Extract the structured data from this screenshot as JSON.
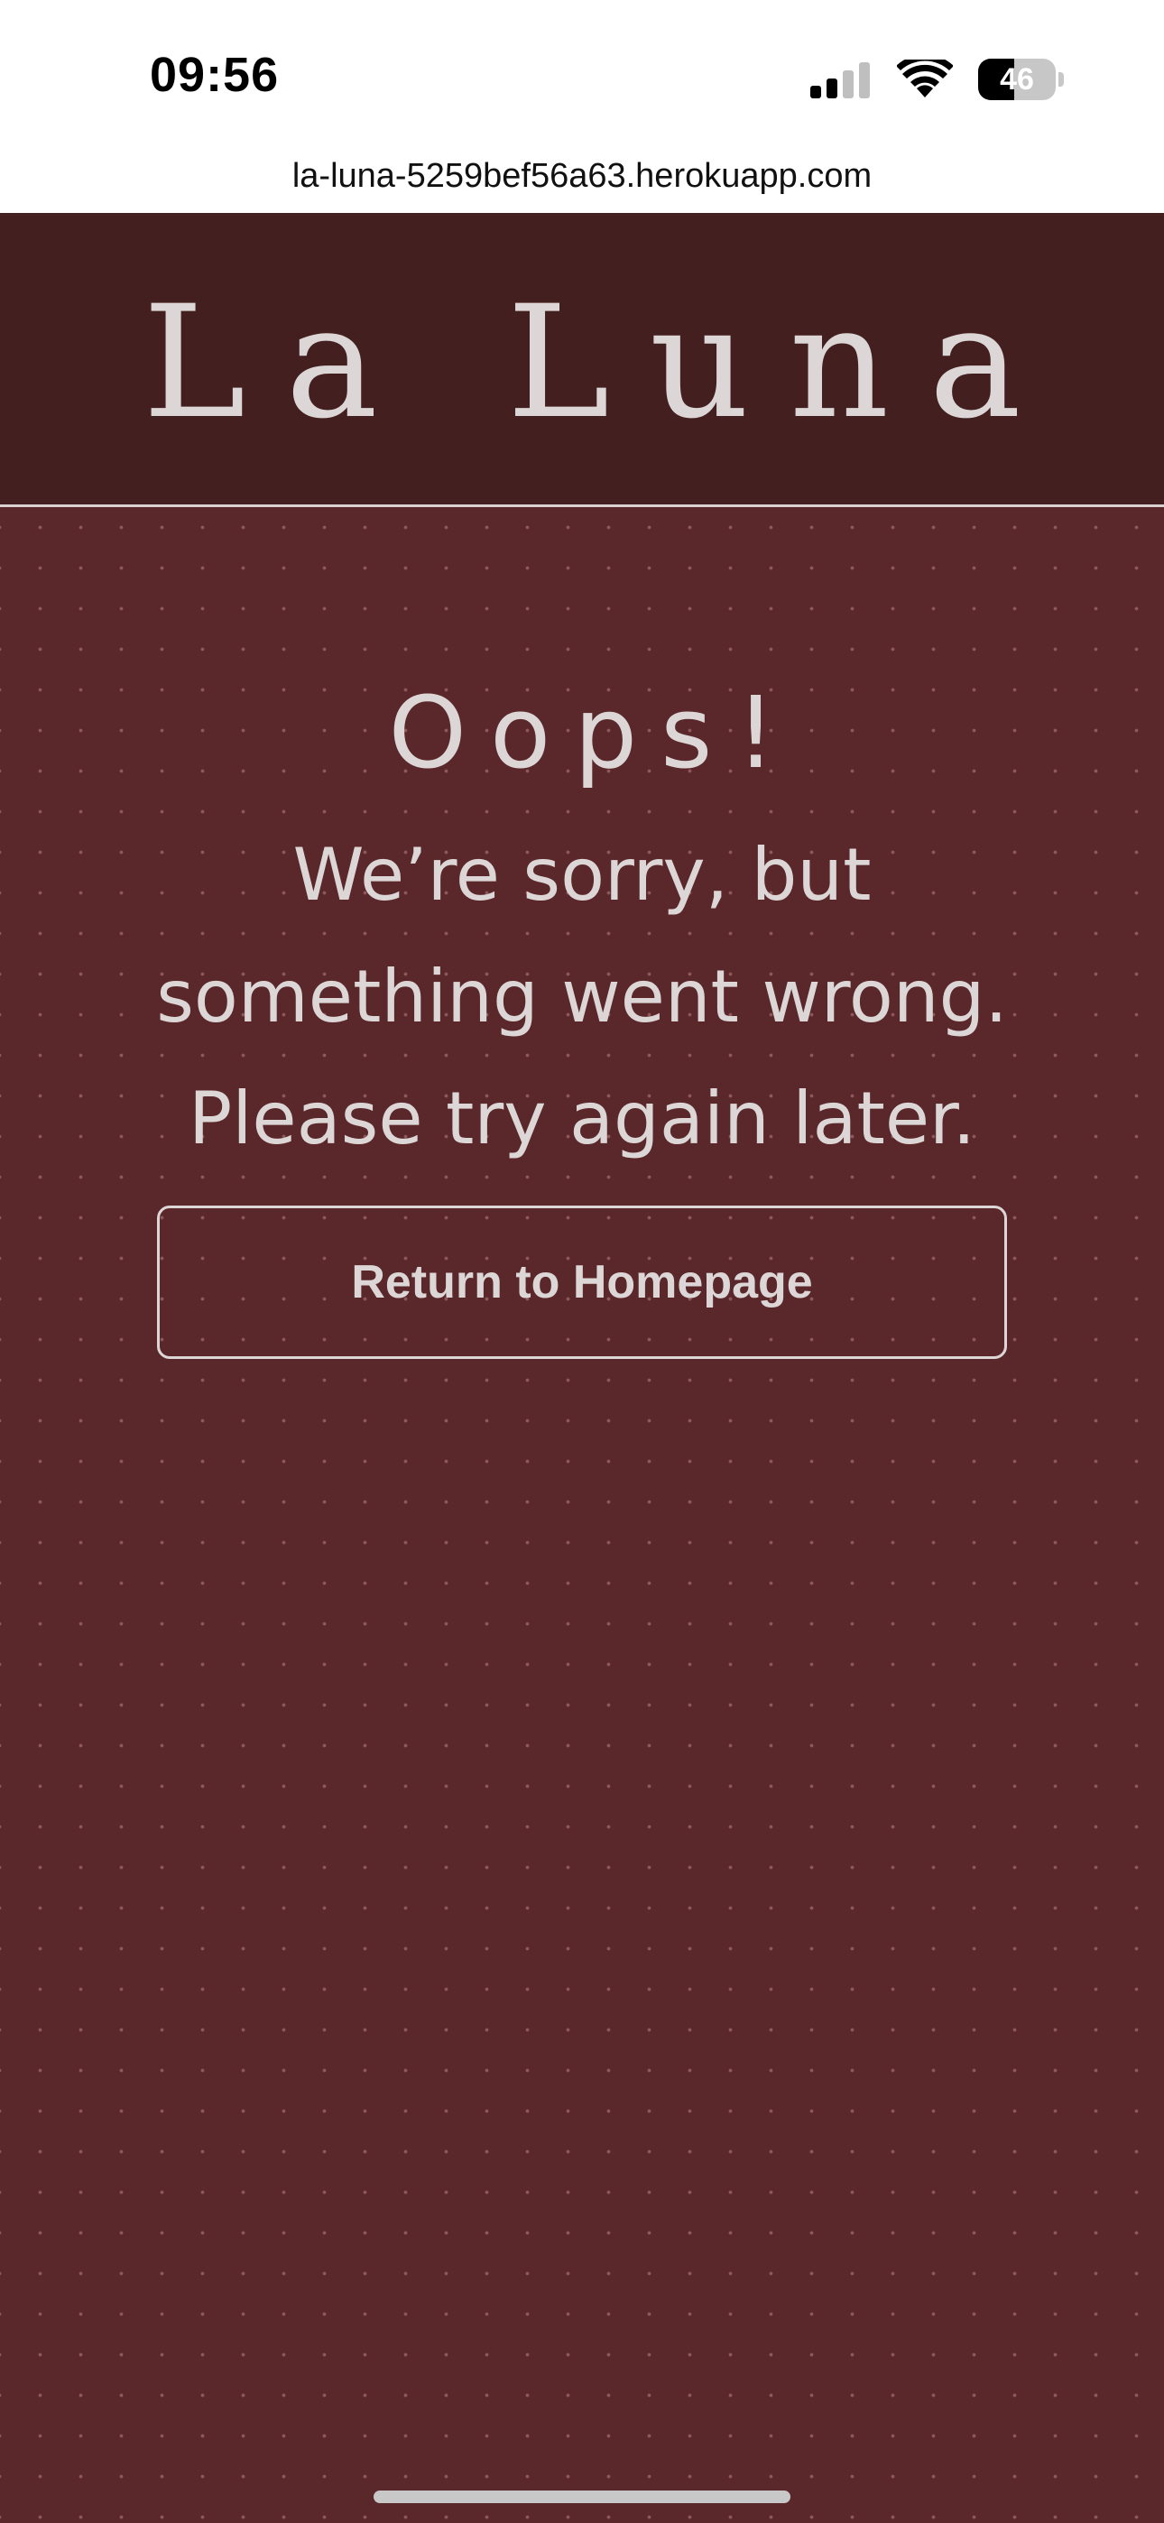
{
  "status_bar": {
    "time": "09:56",
    "battery_level": "46",
    "battery_percent": 46,
    "signal_bars_active": 2,
    "signal_bars_total": 4
  },
  "browser": {
    "url": "la-luna-5259bef56a63.herokuapp.com"
  },
  "header": {
    "logo_text": "La Luna"
  },
  "error_page": {
    "title": "Oops!",
    "message": "We’re sorry, but something went wrong. Please try again later.",
    "button_label": "Return to Homepage"
  },
  "colors": {
    "header_bg": "#431f20",
    "page_bg": "#5a272a",
    "text": "#ddd6d6"
  }
}
